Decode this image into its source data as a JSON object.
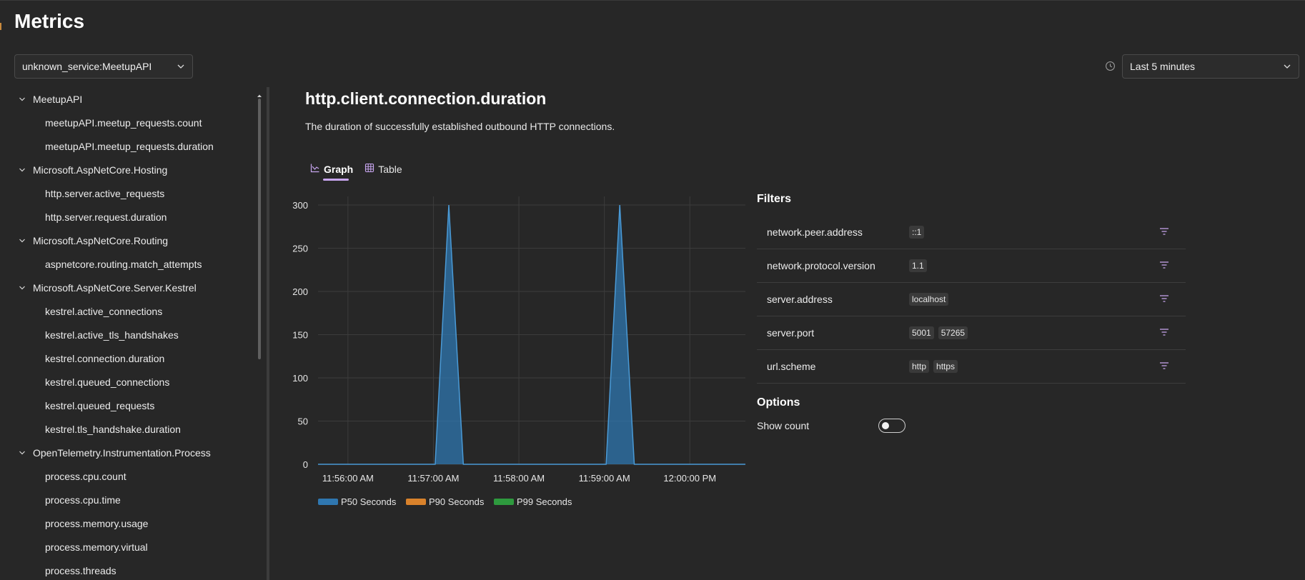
{
  "page": {
    "title": "Metrics"
  },
  "service_select": {
    "value": "unknown_service:MeetupAPI"
  },
  "time_select": {
    "value": "Last 5 minutes"
  },
  "sidebar": {
    "groups": [
      {
        "label": "MeetupAPI",
        "items": [
          "meetupAPI.meetup_requests.count",
          "meetupAPI.meetup_requests.duration"
        ]
      },
      {
        "label": "Microsoft.AspNetCore.Hosting",
        "items": [
          "http.server.active_requests",
          "http.server.request.duration"
        ]
      },
      {
        "label": "Microsoft.AspNetCore.Routing",
        "items": [
          "aspnetcore.routing.match_attempts"
        ]
      },
      {
        "label": "Microsoft.AspNetCore.Server.Kestrel",
        "items": [
          "kestrel.active_connections",
          "kestrel.active_tls_handshakes",
          "kestrel.connection.duration",
          "kestrel.queued_connections",
          "kestrel.queued_requests",
          "kestrel.tls_handshake.duration"
        ]
      },
      {
        "label": "OpenTelemetry.Instrumentation.Process",
        "items": [
          "process.cpu.count",
          "process.cpu.time",
          "process.memory.usage",
          "process.memory.virtual",
          "process.threads"
        ]
      }
    ]
  },
  "metric": {
    "title": "http.client.connection.duration",
    "description": "The duration of successfully established outbound HTTP connections."
  },
  "tabs": [
    {
      "label": "Graph",
      "icon": "chart-icon",
      "active": true
    },
    {
      "label": "Table",
      "icon": "table-icon",
      "active": false
    }
  ],
  "filters": {
    "title": "Filters",
    "rows": [
      {
        "name": "network.peer.address",
        "values": [
          "::1"
        ]
      },
      {
        "name": "network.protocol.version",
        "values": [
          "1.1"
        ]
      },
      {
        "name": "server.address",
        "values": [
          "localhost"
        ]
      },
      {
        "name": "server.port",
        "values": [
          "5001",
          "57265"
        ]
      },
      {
        "name": "url.scheme",
        "values": [
          "http",
          "https"
        ]
      }
    ]
  },
  "options": {
    "title": "Options",
    "show_count_label": "Show count",
    "show_count": false
  },
  "chart_data": {
    "type": "area",
    "x_labels": [
      "11:56:00 AM",
      "11:57:00 AM",
      "11:58:00 AM",
      "11:59:00 AM",
      "12:00:00 PM"
    ],
    "x_range_minutes": [
      -0.35,
      4.65
    ],
    "ylim": [
      0,
      300
    ],
    "y_ticks": [
      0,
      50,
      100,
      150,
      200,
      250,
      300
    ],
    "grid": true,
    "legend_position": "bottom",
    "series": [
      {
        "name": "P50 Seconds",
        "color": "#2f77b0",
        "points": [
          [
            -0.35,
            0
          ],
          [
            1.02,
            0
          ],
          [
            1.18,
            300
          ],
          [
            1.35,
            0
          ],
          [
            3.02,
            0
          ],
          [
            3.18,
            300
          ],
          [
            3.35,
            0
          ],
          [
            4.65,
            0
          ]
        ]
      },
      {
        "name": "P90 Seconds",
        "color": "#d9822b",
        "points": []
      },
      {
        "name": "P99 Seconds",
        "color": "#2e9a3e",
        "points": []
      }
    ]
  }
}
